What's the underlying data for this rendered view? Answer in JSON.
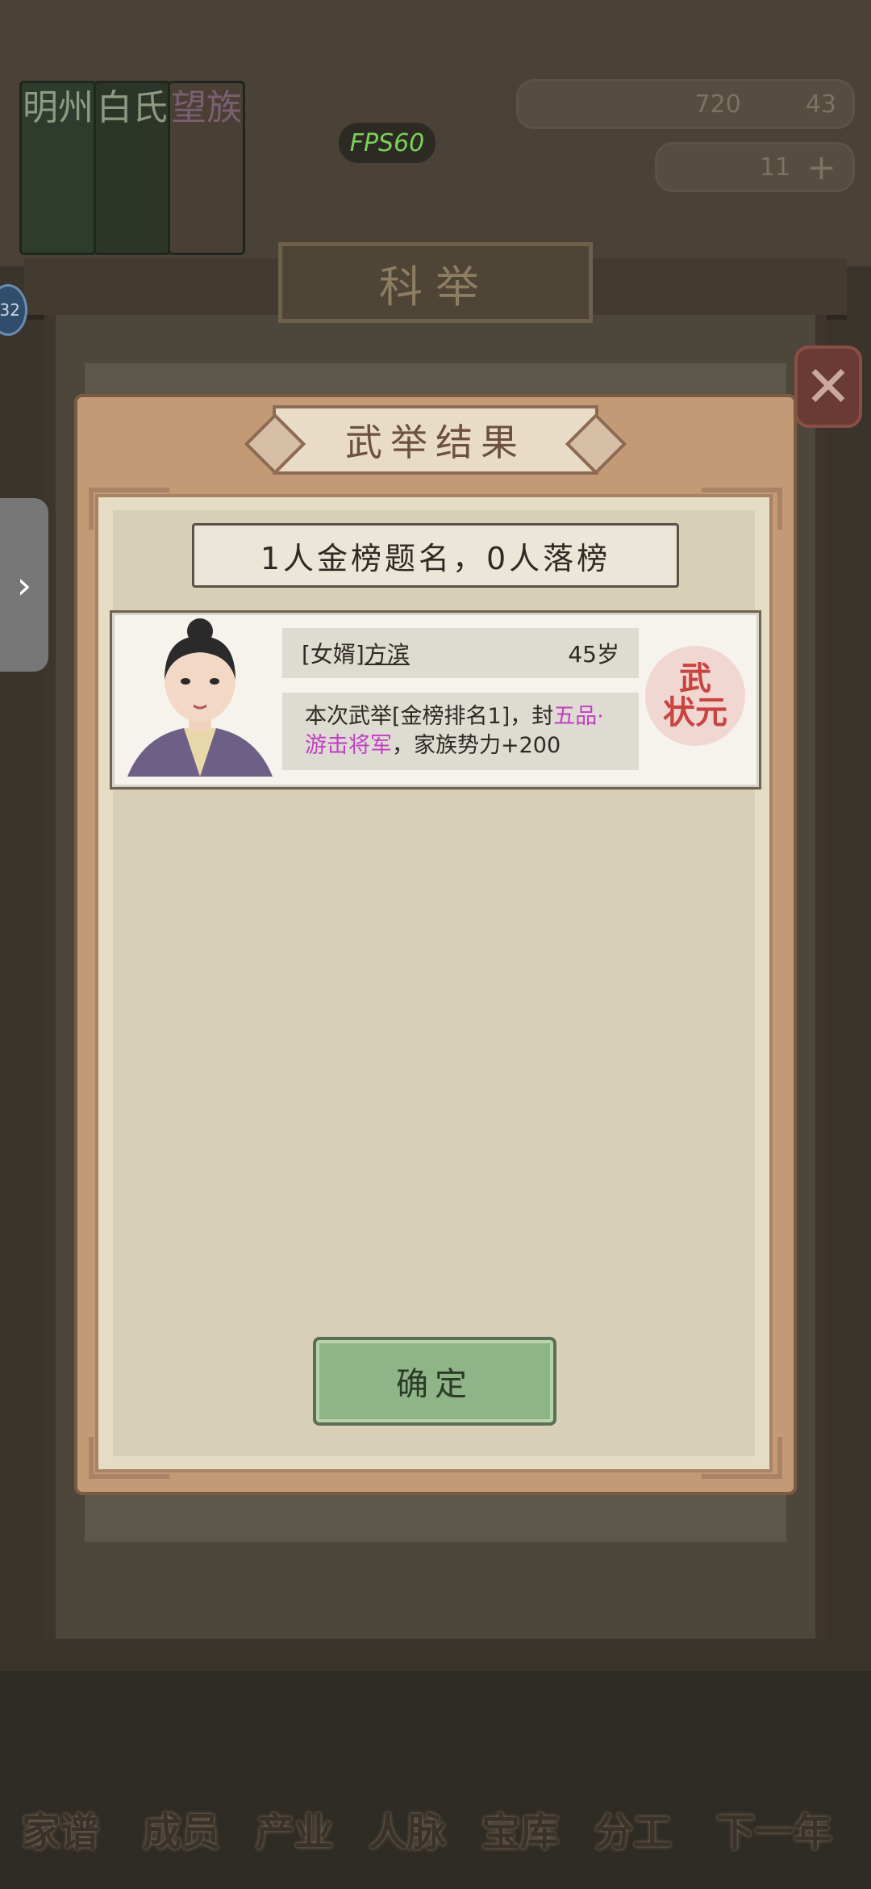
{
  "background": {
    "clan_labels": [
      "明州",
      "白氏",
      "望族"
    ],
    "fps": "FPS60",
    "resource_a": "720",
    "resource_b": "43",
    "resource_c": "11",
    "section_title": "科举",
    "level": "32",
    "nav": [
      "家谱",
      "成员",
      "产业",
      "人脉",
      "宝库",
      "分工",
      "下一年"
    ]
  },
  "modal": {
    "title": "武举结果",
    "summary": "1人金榜题名，0人落榜",
    "result": {
      "relation": "[女婿]",
      "name": "方滨",
      "age": "45岁",
      "desc_prefix": "本次武举[金榜排名1]，封",
      "rank": "五品·游击将军",
      "desc_suffix": "，家族势力+200",
      "seal_line1": "武",
      "seal_line2": "状元"
    },
    "confirm_label": "确定"
  },
  "colors": {
    "rank_highlight": "#c23fc4",
    "seal_red": "#c94441",
    "confirm_green": "#8fb487"
  }
}
